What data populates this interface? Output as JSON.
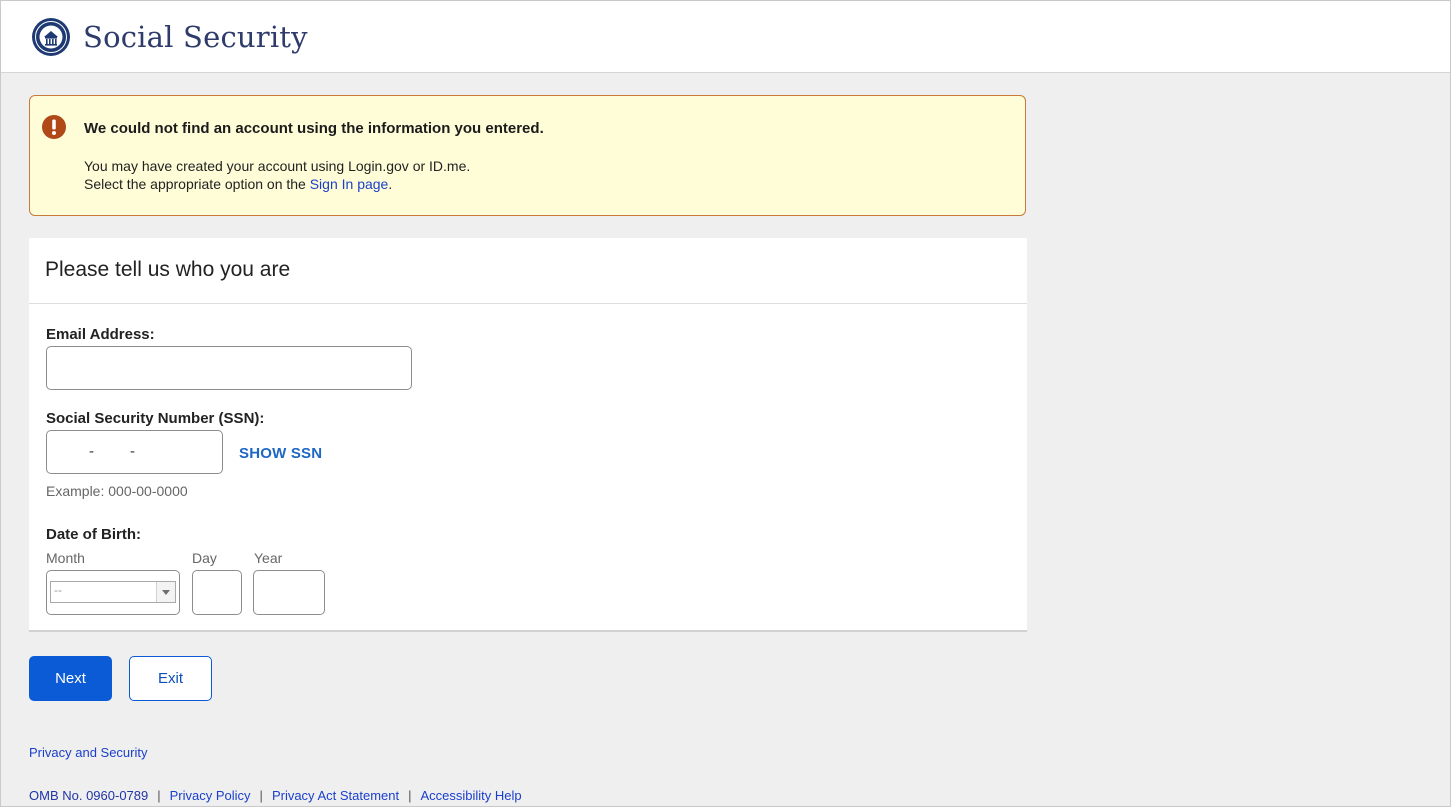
{
  "header": {
    "site_title": "Social Security"
  },
  "alert": {
    "title": "We could not find an account using the information you entered.",
    "line1": "You may have created your account using Login.gov or ID.me.",
    "line2_prefix": "Select the appropriate option on the ",
    "line2_link": "Sign In page",
    "line2_suffix": "."
  },
  "form": {
    "heading": "Please tell us who you are",
    "email_label": "Email Address:",
    "email_value": "",
    "ssn_label": "Social Security Number (SSN):",
    "ssn_dash": "-",
    "show_ssn": "SHOW SSN",
    "ssn_example": "Example: 000-00-0000",
    "dob_label": "Date of Birth:",
    "month_label": "Month",
    "day_label": "Day",
    "year_label": "Year",
    "month_selected": "--"
  },
  "buttons": {
    "next": "Next",
    "exit": "Exit"
  },
  "footer": {
    "privacy_security": "Privacy and Security",
    "omb": "OMB No. 0960-0789",
    "sep": "|",
    "privacy_policy": "Privacy Policy",
    "privacy_act": "Privacy Act Statement",
    "accessibility": "Accessibility Help"
  },
  "colors": {
    "primary_button": "#0b5bd6",
    "alert_background": "#fffdd8",
    "alert_border": "#c9793a",
    "alert_icon": "#b04818",
    "link": "#1a3fcc",
    "brand_title": "#2e3b6b"
  }
}
